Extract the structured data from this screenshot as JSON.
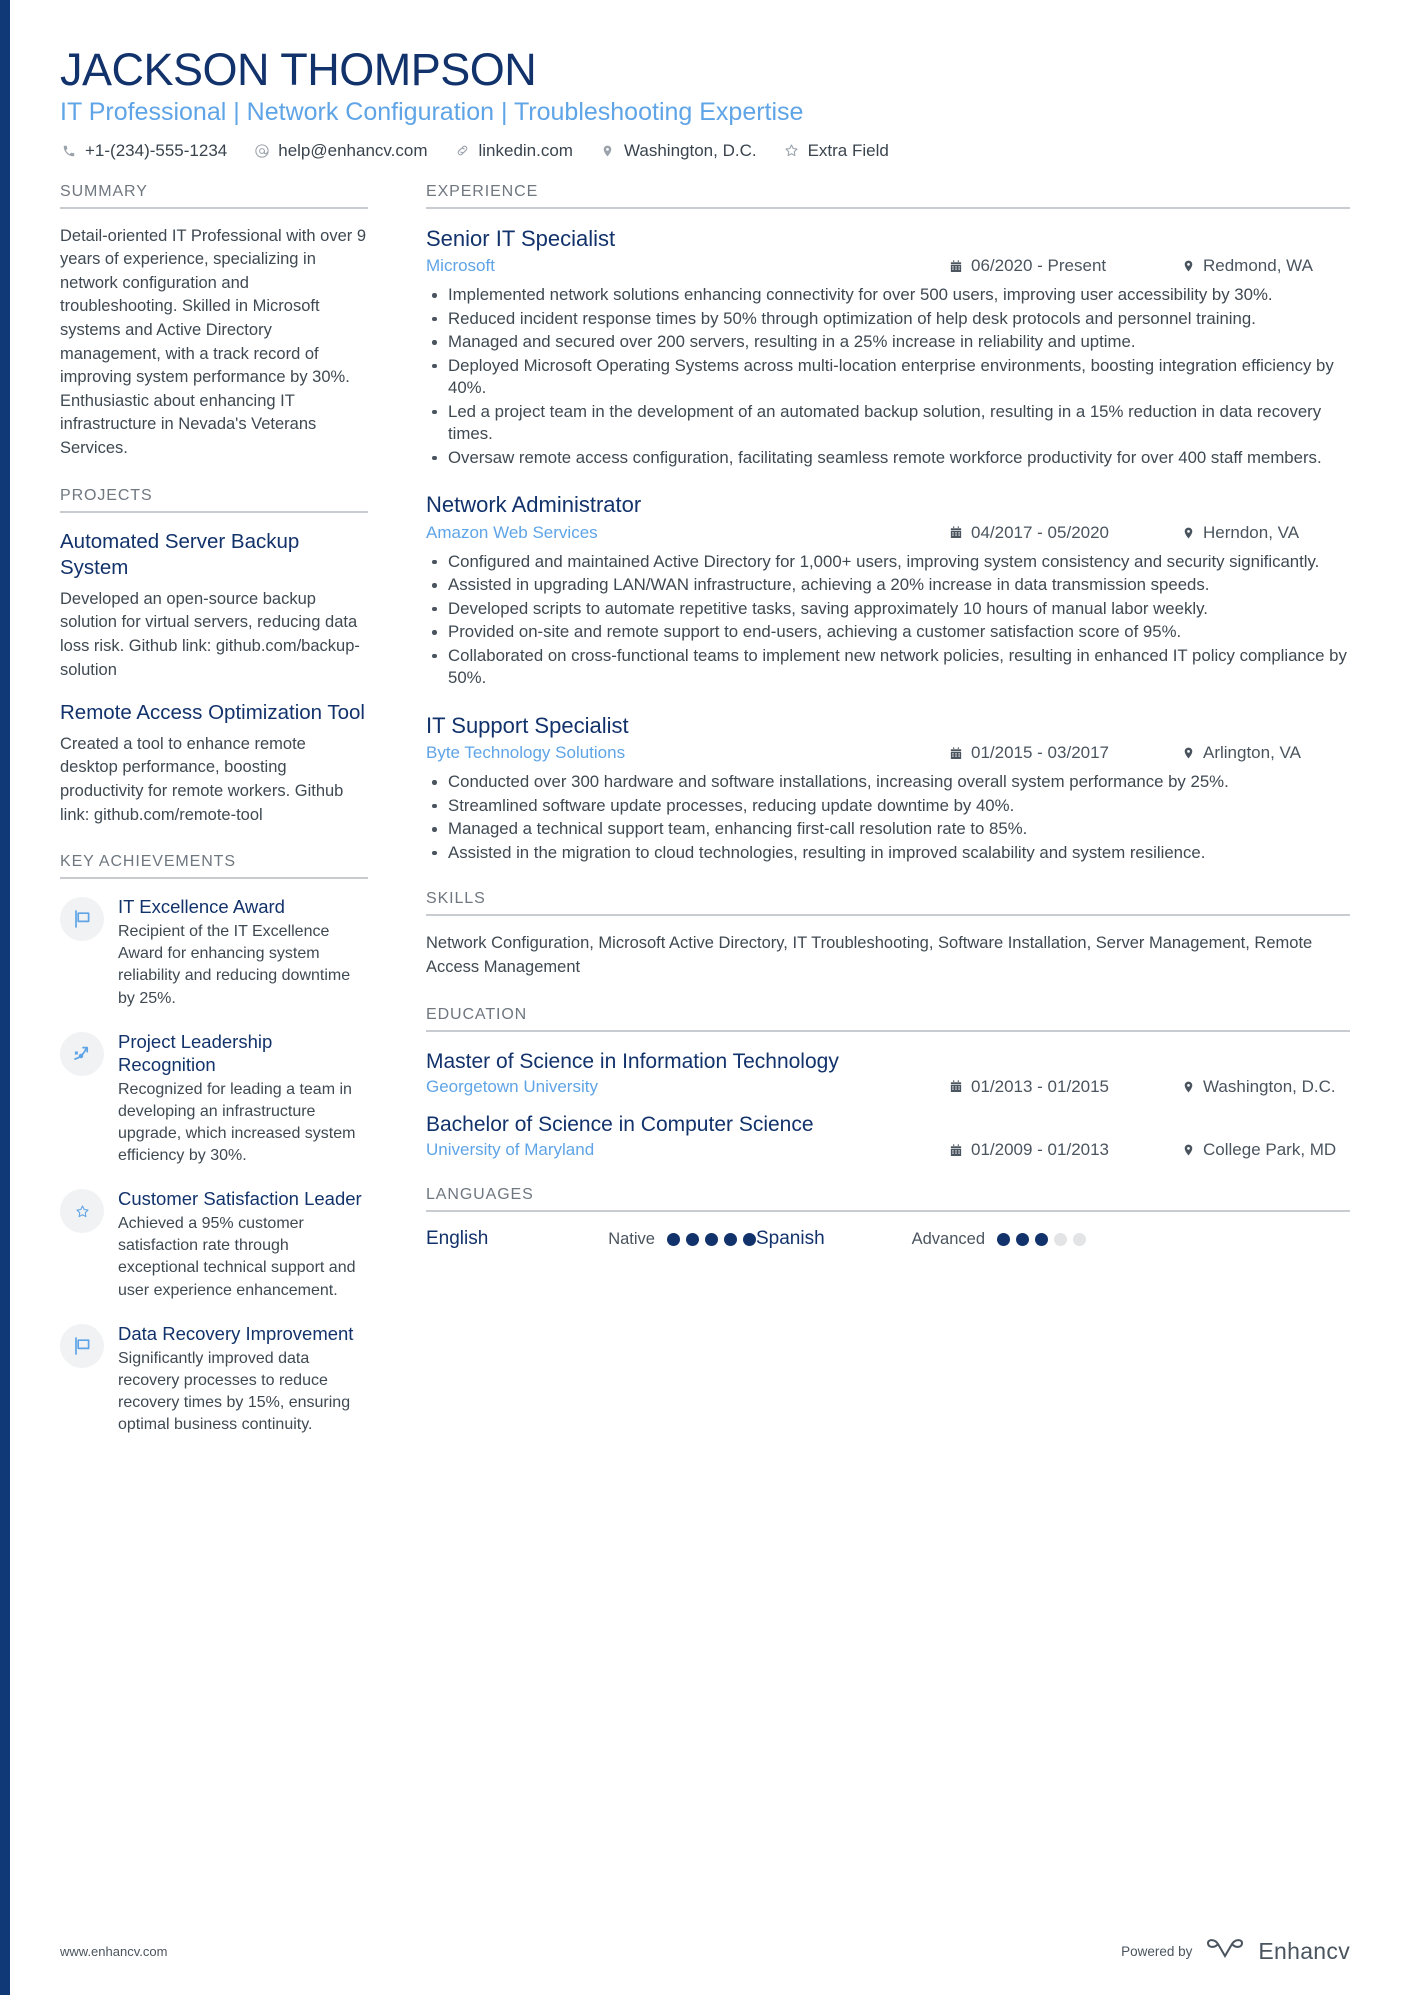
{
  "accent_color": "#12326b",
  "light_accent_color": "#5fa4e6",
  "header": {
    "name": "JACKSON THOMPSON",
    "headline": "IT Professional | Network Configuration | Troubleshooting Expertise",
    "contacts": [
      {
        "icon": "phone-icon",
        "text": "+1-(234)-555-1234"
      },
      {
        "icon": "email-icon",
        "text": "help@enhancv.com"
      },
      {
        "icon": "link-icon",
        "text": "linkedin.com"
      },
      {
        "icon": "location-pin-icon",
        "text": "Washington, D.C."
      },
      {
        "icon": "star-icon",
        "text": "Extra Field"
      }
    ]
  },
  "summary": {
    "title": "SUMMARY",
    "text": "Detail-oriented IT Professional with over 9 years of experience, specializing in network configuration and troubleshooting. Skilled in Microsoft systems and Active Directory management, with a track record of improving system performance by 30%. Enthusiastic about enhancing IT infrastructure in Nevada's Veterans Services."
  },
  "projects": {
    "title": "PROJECTS",
    "items": [
      {
        "name": "Automated Server Backup System",
        "description": "Developed an open-source backup solution for virtual servers, reducing data loss risk. Github link: github.com/backup-solution"
      },
      {
        "name": "Remote Access Optimization Tool",
        "description": "Created a tool to enhance remote desktop performance, boosting productivity for remote workers. Github link: github.com/remote-tool"
      }
    ]
  },
  "key_achievements": {
    "title": "KEY ACHIEVEMENTS",
    "items": [
      {
        "icon": "flag-icon",
        "title": "IT Excellence Award",
        "description": "Recipient of the IT Excellence Award for enhancing system reliability and reducing downtime by 25%."
      },
      {
        "icon": "trending-up-icon",
        "title": "Project Leadership Recognition",
        "description": "Recognized for leading a team in developing an infrastructure upgrade, which increased system efficiency by 30%."
      },
      {
        "icon": "star-icon",
        "title": "Customer Satisfaction Leader",
        "description": "Achieved a 95% customer satisfaction rate through exceptional technical support and user experience enhancement."
      },
      {
        "icon": "flag-icon",
        "title": "Data Recovery Improvement",
        "description": "Significantly improved data recovery processes to reduce recovery times by 15%, ensuring optimal business continuity."
      }
    ]
  },
  "experience": {
    "title": "EXPERIENCE",
    "jobs": [
      {
        "title": "Senior IT Specialist",
        "company": "Microsoft",
        "dates": "06/2020 - Present",
        "location": "Redmond, WA",
        "bullets": [
          "Implemented network solutions enhancing connectivity for over 500 users, improving user accessibility by 30%.",
          "Reduced incident response times by 50% through optimization of help desk protocols and personnel training.",
          "Managed and secured over 200 servers, resulting in a 25% increase in reliability and uptime.",
          "Deployed Microsoft Operating Systems across multi-location enterprise environments, boosting integration efficiency by 40%.",
          "Led a project team in the development of an automated backup solution, resulting in a 15% reduction in data recovery times.",
          "Oversaw remote access configuration, facilitating seamless remote workforce productivity for over 400 staff members."
        ]
      },
      {
        "title": "Network Administrator",
        "company": "Amazon Web Services",
        "dates": "04/2017 - 05/2020",
        "location": "Herndon, VA",
        "bullets": [
          "Configured and maintained Active Directory for 1,000+ users, improving system consistency and security significantly.",
          "Assisted in upgrading LAN/WAN infrastructure, achieving a 20% increase in data transmission speeds.",
          "Developed scripts to automate repetitive tasks, saving approximately 10 hours of manual labor weekly.",
          "Provided on-site and remote support to end-users, achieving a customer satisfaction score of 95%.",
          "Collaborated on cross-functional teams to implement new network policies, resulting in enhanced IT policy compliance by 50%."
        ]
      },
      {
        "title": "IT Support Specialist",
        "company": "Byte Technology Solutions",
        "dates": "01/2015 - 03/2017",
        "location": "Arlington, VA",
        "bullets": [
          "Conducted over 300 hardware and software installations, increasing overall system performance by 25%.",
          "Streamlined software update processes, reducing update downtime by 40%.",
          "Managed a technical support team, enhancing first-call resolution rate to 85%.",
          "Assisted in the migration to cloud technologies, resulting in improved scalability and system resilience."
        ]
      }
    ]
  },
  "skills": {
    "title": "SKILLS",
    "text": "Network Configuration, Microsoft Active Directory, IT Troubleshooting, Software Installation, Server Management, Remote Access Management"
  },
  "education": {
    "title": "EDUCATION",
    "items": [
      {
        "degree": "Master of Science in Information Technology",
        "school": "Georgetown University",
        "dates": "01/2013 - 01/2015",
        "location": "Washington, D.C."
      },
      {
        "degree": "Bachelor of Science in Computer Science",
        "school": "University of Maryland",
        "dates": "01/2009 - 01/2013",
        "location": "College Park, MD"
      }
    ]
  },
  "languages": {
    "title": "LANGUAGES",
    "items": [
      {
        "name": "English",
        "level": "Native",
        "filled": 5,
        "total": 5
      },
      {
        "name": "Spanish",
        "level": "Advanced",
        "filled": 3,
        "total": 5
      }
    ]
  },
  "footer": {
    "url": "www.enhancv.com",
    "powered_by": "Powered by",
    "brand": "Enhancv"
  }
}
